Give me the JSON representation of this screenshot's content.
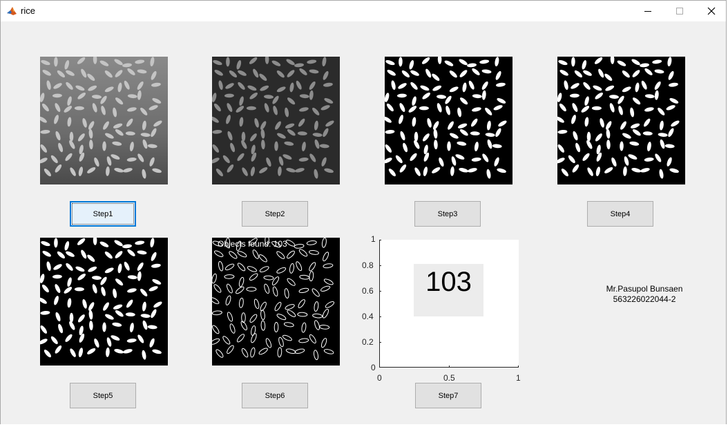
{
  "window": {
    "title": "rice",
    "controls": [
      "minimize",
      "maximize",
      "close"
    ]
  },
  "buttons": {
    "step1": "Step1",
    "step2": "Step2",
    "step3": "Step3",
    "step4": "Step4",
    "step5": "Step5",
    "step6": "Step6",
    "step7": "Step7"
  },
  "images": {
    "step6_overlay": "Objects found: 103"
  },
  "result_axes": {
    "count_value": "103",
    "x_ticks": [
      "0",
      "0.5",
      "1"
    ],
    "y_ticks": [
      "0",
      "0.2",
      "0.4",
      "0.6",
      "0.8",
      "1"
    ],
    "xlim": [
      0,
      1
    ],
    "ylim": [
      0,
      1
    ]
  },
  "author": {
    "name": "Mr.Pasupol Bunsaen",
    "id": "563226022044-2"
  },
  "colors": {
    "figure_bg": "#f0f0f0",
    "button_bg": "#e1e1e1",
    "focus_border": "#0078d7",
    "count_box_bg": "#ececec"
  }
}
